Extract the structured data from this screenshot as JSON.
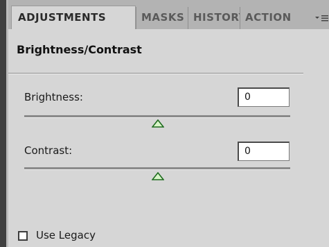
{
  "tabs": [
    {
      "label": "ADJUSTMENTS"
    },
    {
      "label": "MASKS"
    },
    {
      "label": "HISTORY"
    },
    {
      "label": "ACTIONS"
    }
  ],
  "panel": {
    "title": "Brightness/Contrast",
    "menu_icon": "panel-menu-icon"
  },
  "brightness": {
    "label": "Brightness:",
    "value": "0"
  },
  "contrast": {
    "label": "Contrast:",
    "value": "0"
  },
  "use_legacy": {
    "label": "Use Legacy",
    "checked": false
  },
  "colors": {
    "thumb_fill": "#d8f5c8",
    "thumb_stroke": "#1e6b1e"
  }
}
